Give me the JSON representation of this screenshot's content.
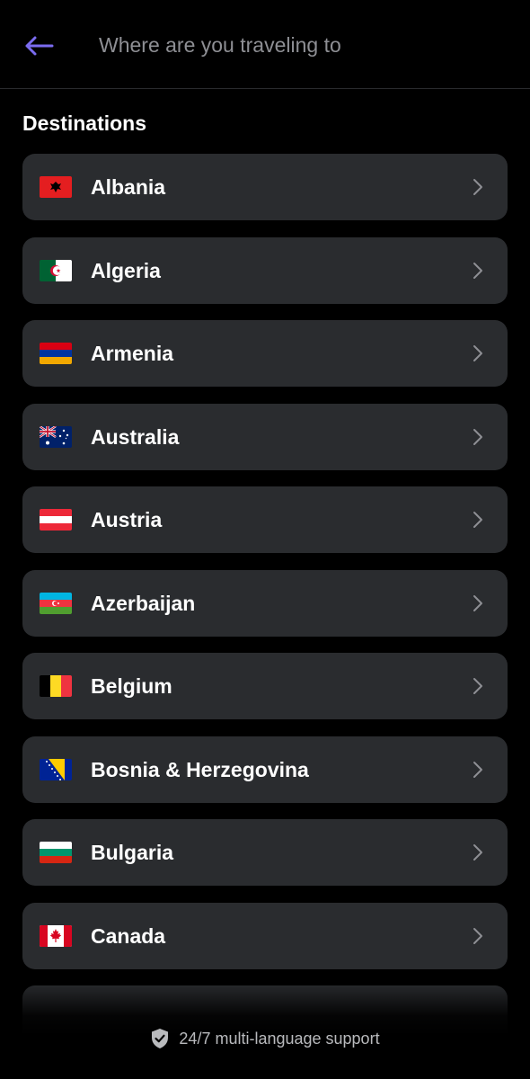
{
  "header": {
    "search_placeholder": "Where are you traveling to",
    "back_icon": "arrow-left-icon",
    "accent_color": "#7b6cf0"
  },
  "section": {
    "title": "Destinations"
  },
  "destinations": [
    {
      "label": "Albania",
      "flag": "al"
    },
    {
      "label": "Algeria",
      "flag": "dz"
    },
    {
      "label": "Armenia",
      "flag": "am"
    },
    {
      "label": "Australia",
      "flag": "au"
    },
    {
      "label": "Austria",
      "flag": "at"
    },
    {
      "label": "Azerbaijan",
      "flag": "az"
    },
    {
      "label": "Belgium",
      "flag": "be"
    },
    {
      "label": "Bosnia & Herzegovina",
      "flag": "ba"
    },
    {
      "label": "Bulgaria",
      "flag": "bg"
    },
    {
      "label": "Canada",
      "flag": "ca"
    }
  ],
  "footer": {
    "text": "24/7 multi-language support",
    "icon": "shield-check-icon"
  }
}
